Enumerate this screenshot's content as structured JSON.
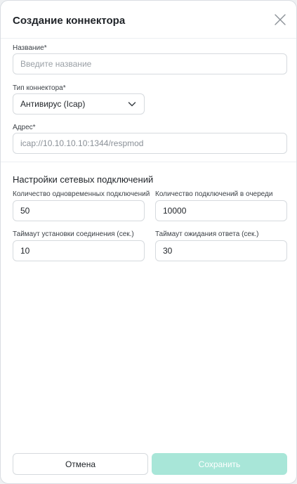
{
  "dialog": {
    "title": "Создание коннектора"
  },
  "form": {
    "name": {
      "label": "Название*",
      "placeholder": "Введите название",
      "value": ""
    },
    "type": {
      "label": "Тип коннектора*",
      "value": "Антивирус (Icap)"
    },
    "address": {
      "label": "Адрес*",
      "value": "icap://10.10.10.10:1344/respmod"
    }
  },
  "network": {
    "title": "Настройки сетевых подключений",
    "concurrent": {
      "label": "Количество одновременных подключений",
      "value": "50"
    },
    "queue": {
      "label": "Количество подключений в очереди",
      "value": "10000"
    },
    "connect_timeout": {
      "label": "Таймаут установки соединения (сек.)",
      "value": "10"
    },
    "response_timeout": {
      "label": "Таймаут ожидания ответа (сек.)",
      "value": "30"
    }
  },
  "footer": {
    "cancel_label": "Отмена",
    "save_label": "Сохранить"
  },
  "colors": {
    "save_button_bg": "#a8e6d8",
    "border": "#d6dade"
  },
  "icons": {
    "close": "close-icon",
    "dropdown": "chevron-down-icon"
  }
}
